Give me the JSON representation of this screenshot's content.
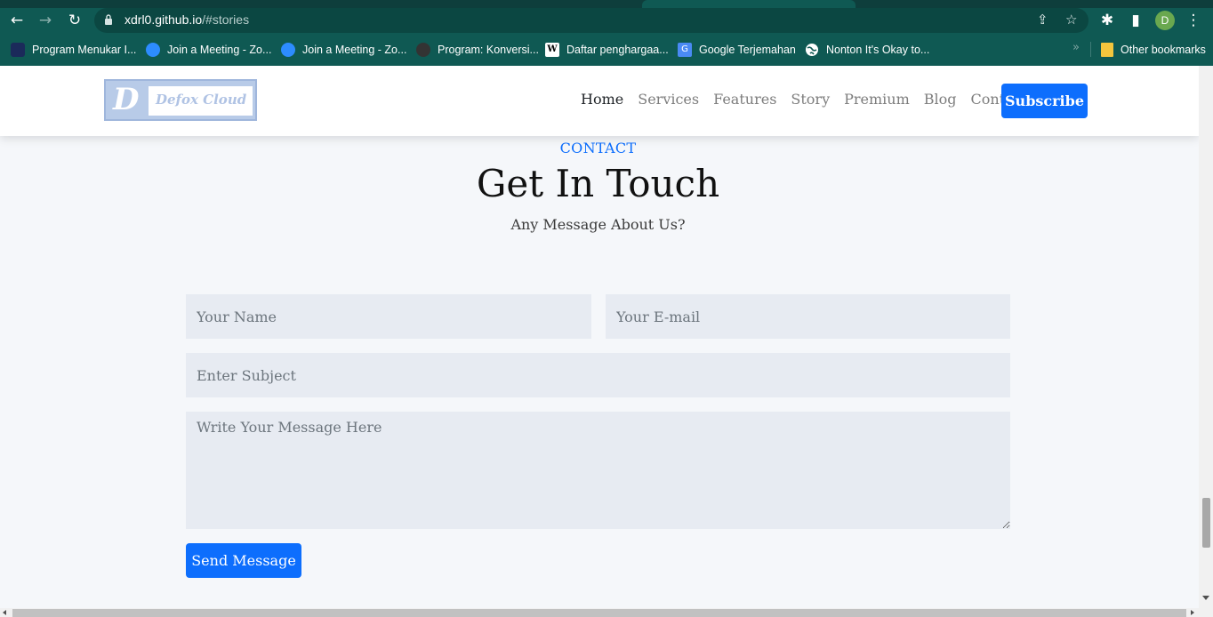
{
  "browser": {
    "url_host": "xdrl0.github.io",
    "url_path": "/#stories",
    "profile_initial": "D",
    "bookmarks": [
      {
        "label": "Program Menukar I...",
        "icon": "app-icon"
      },
      {
        "label": "Join a Meeting - Zo...",
        "icon": "zoom-icon"
      },
      {
        "label": "Join a Meeting - Zo...",
        "icon": "zoom-icon"
      },
      {
        "label": "Program: Konversi...",
        "icon": "site-icon"
      },
      {
        "label": "Daftar penghargaa...",
        "icon": "wikipedia-icon"
      },
      {
        "label": "Google Terjemahan",
        "icon": "google-translate-icon"
      },
      {
        "label": "Nonton It's Okay to...",
        "icon": "globe-icon"
      }
    ],
    "other_bookmarks": "Other bookmarks",
    "wiki_glyph": "W",
    "gt_glyph": "G",
    "more_glyph": "»"
  },
  "site": {
    "logo_letter": "D",
    "logo_text": "Defox Cloud",
    "nav": [
      {
        "label": "Home",
        "active": true
      },
      {
        "label": "Services"
      },
      {
        "label": "Features"
      },
      {
        "label": "Story"
      },
      {
        "label": "Premium"
      },
      {
        "label": "Blog"
      },
      {
        "label": "Contact"
      }
    ],
    "subscribe_label": "Subscribe"
  },
  "contact": {
    "eyebrow": "CONTACT",
    "title": "Get In Touch",
    "subtitle": "Any Message About Us?",
    "name_placeholder": "Your Name",
    "email_placeholder": "Your E-mail",
    "subject_placeholder": "Enter Subject",
    "message_placeholder": "Write Your Message Here",
    "send_label": "Send Message"
  },
  "colors": {
    "chrome": "#0f5953",
    "primary": "#0d6efd",
    "field_bg": "#e7ebf2"
  }
}
